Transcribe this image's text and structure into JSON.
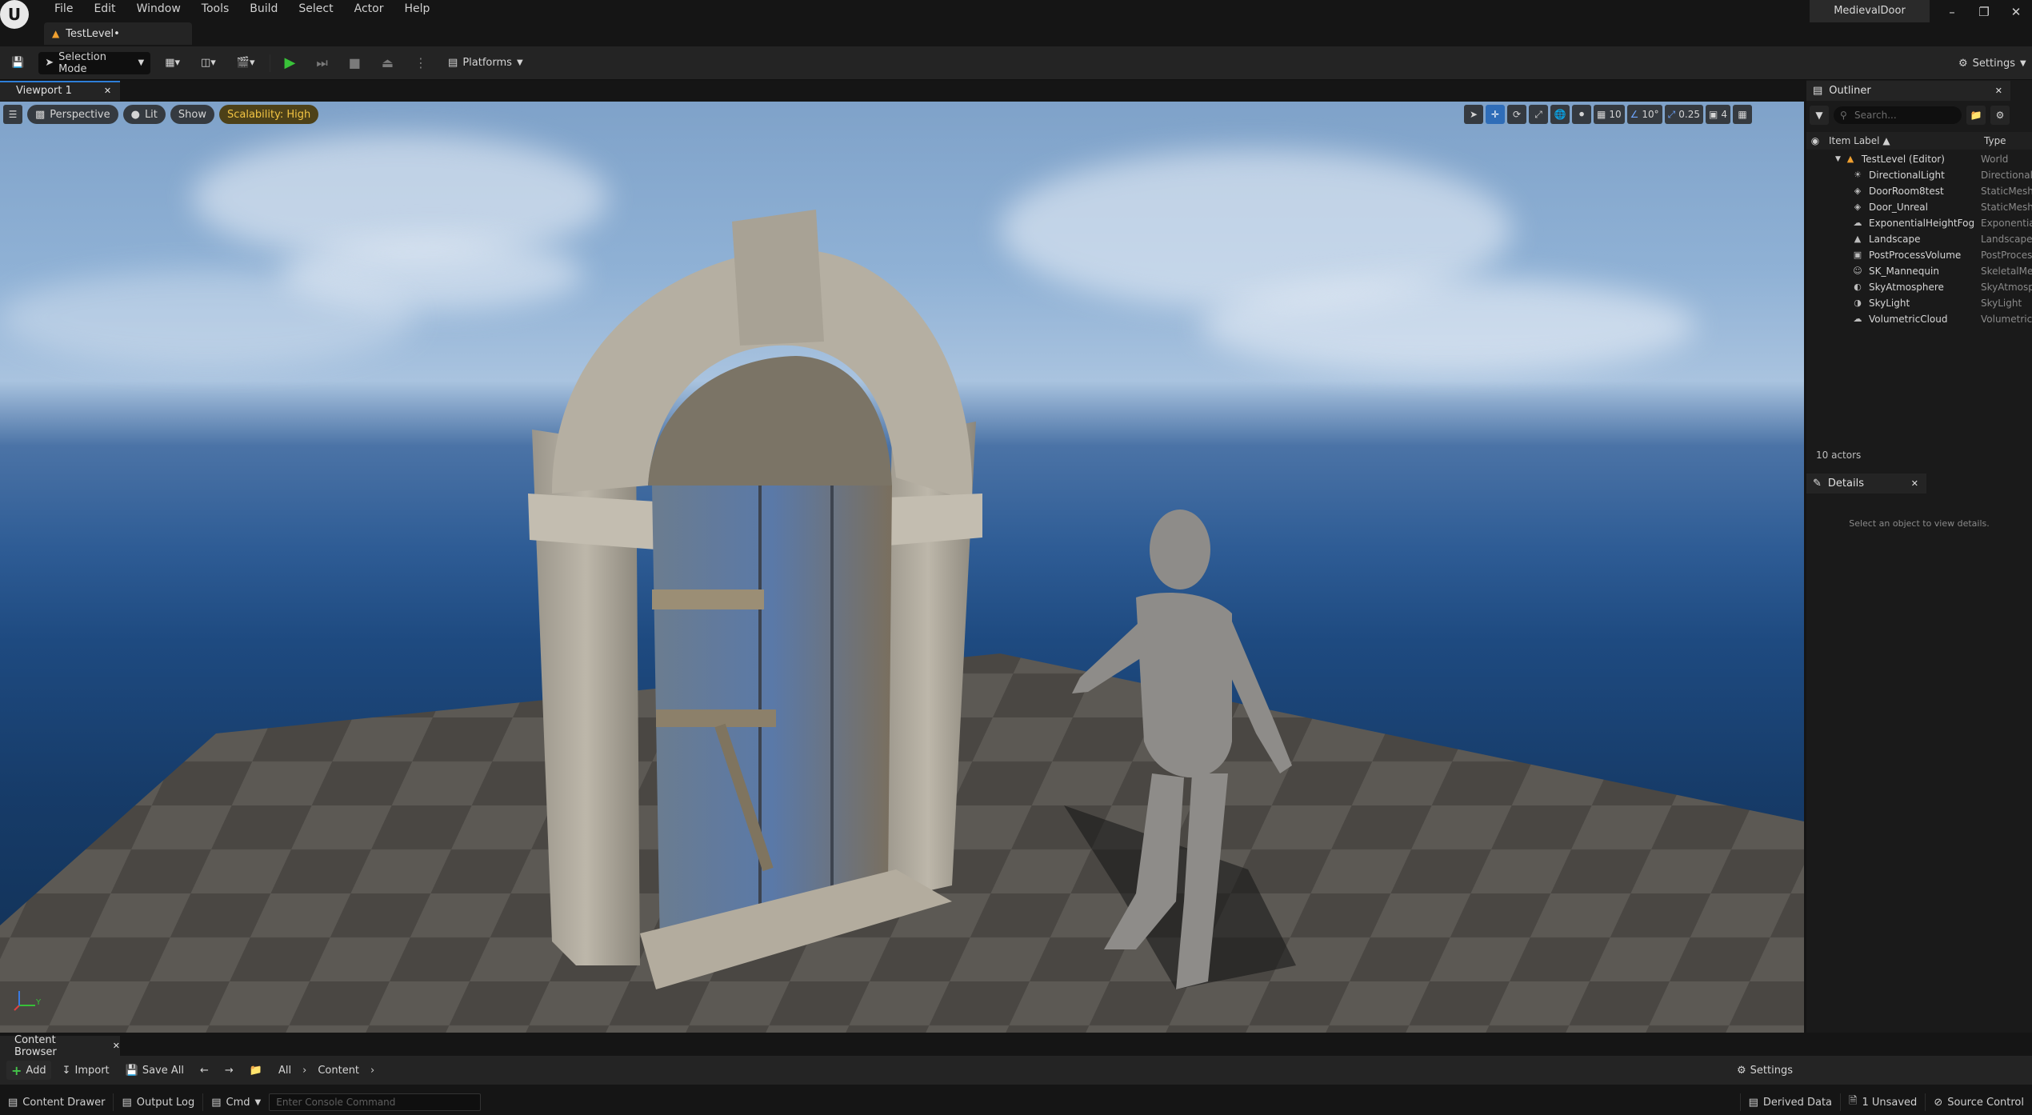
{
  "app": {
    "project_name": "MedievalDoor",
    "level_tab": "TestLevel•",
    "menu": [
      "File",
      "Edit",
      "Window",
      "Tools",
      "Build",
      "Select",
      "Actor",
      "Help"
    ]
  },
  "toolbar": {
    "selection_mode": "Selection Mode",
    "platforms": "Platforms",
    "settings": "Settings"
  },
  "viewport": {
    "tab": "Viewport 1",
    "perspective": "Perspective",
    "lit": "Lit",
    "show": "Show",
    "scalability": "Scalability: High",
    "grid_snap": "10",
    "rotation_snap": "10°",
    "scale_snap": "0.25",
    "camera_speed": "4",
    "axis_label": "Y"
  },
  "outliner": {
    "tab": "Outliner",
    "search_placeholder": "Search...",
    "col_label": "Item Label ▲",
    "col_type": "Type",
    "root": {
      "name": "TestLevel (Editor)",
      "type": "World"
    },
    "items": [
      {
        "name": "DirectionalLight",
        "type": "DirectionalLight",
        "icon": "☀"
      },
      {
        "name": "DoorRoom8test",
        "type": "StaticMeshActor",
        "icon": "◈"
      },
      {
        "name": "Door_Unreal",
        "type": "StaticMeshActor",
        "icon": "◈"
      },
      {
        "name": "ExponentialHeightFog",
        "type": "ExponentialHeightFog",
        "icon": "☁"
      },
      {
        "name": "Landscape",
        "type": "Landscape",
        "icon": "▲"
      },
      {
        "name": "PostProcessVolume",
        "type": "PostProcessVolume",
        "icon": "▣"
      },
      {
        "name": "SK_Mannequin",
        "type": "SkeletalMeshActor",
        "icon": "☺"
      },
      {
        "name": "SkyAtmosphere",
        "type": "SkyAtmosphere",
        "icon": "◐"
      },
      {
        "name": "SkyLight",
        "type": "SkyLight",
        "icon": "◑"
      },
      {
        "name": "VolumetricCloud",
        "type": "VolumetricCloud",
        "icon": "☁"
      }
    ],
    "actor_count": "10 actors"
  },
  "details": {
    "tab": "Details",
    "empty_text": "Select an object to view details."
  },
  "content_browser": {
    "tab": "Content Browser",
    "add": "Add",
    "import": "Import",
    "save_all": "Save All",
    "path": [
      "All",
      "Content"
    ],
    "settings": "Settings"
  },
  "statusbar": {
    "content_drawer": "Content Drawer",
    "output_log": "Output Log",
    "cmd": "Cmd",
    "console_placeholder": "Enter Console Command",
    "derived_data": "Derived Data",
    "unsaved": "1 Unsaved",
    "source_control": "Source Control"
  },
  "colors": {
    "accent": "#2e7fd8",
    "play": "#39c239",
    "scalability": "#f2c443"
  }
}
